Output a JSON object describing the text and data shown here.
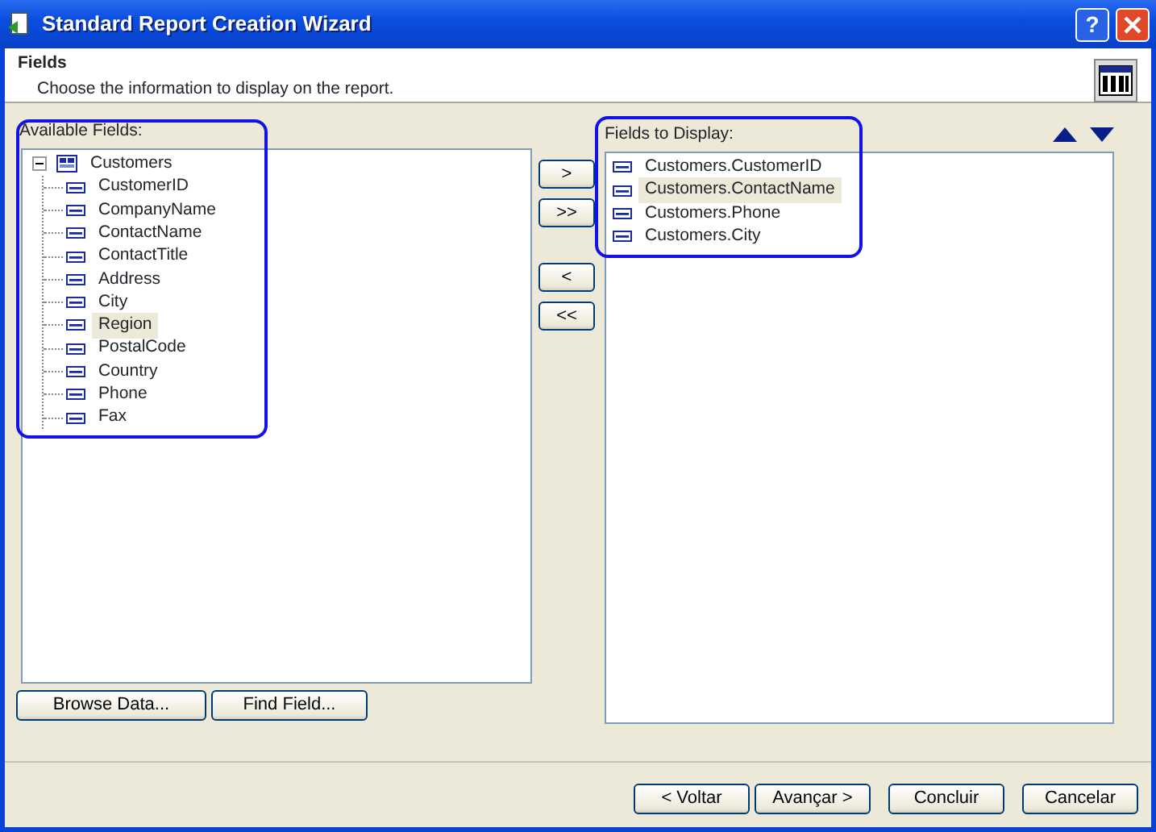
{
  "window": {
    "title": "Standard Report Creation Wizard",
    "help_button": "?"
  },
  "header": {
    "title": "Fields",
    "subtitle": "Choose the information to display on the report."
  },
  "available_fields": {
    "label": "Available Fields:",
    "tree": [
      {
        "label": "Customers",
        "expanded": true,
        "selected": false,
        "children": [
          {
            "label": "CustomerID",
            "selected": false
          },
          {
            "label": "CompanyName",
            "selected": false
          },
          {
            "label": "ContactName",
            "selected": false
          },
          {
            "label": "ContactTitle",
            "selected": false
          },
          {
            "label": "Address",
            "selected": false
          },
          {
            "label": "City",
            "selected": false
          },
          {
            "label": "Region",
            "selected": true
          },
          {
            "label": "PostalCode",
            "selected": false
          },
          {
            "label": "Country",
            "selected": false
          },
          {
            "label": "Phone",
            "selected": false
          },
          {
            "label": "Fax",
            "selected": false
          }
        ]
      }
    ]
  },
  "move_buttons": [
    ">",
    ">>",
    "<",
    "<<"
  ],
  "fields_to_display": {
    "label": "Fields to Display:",
    "items": [
      {
        "label": "Customers.CustomerID",
        "selected": false
      },
      {
        "label": "Customers.ContactName",
        "selected": true
      },
      {
        "label": "Customers.Phone",
        "selected": false
      },
      {
        "label": "Customers.City",
        "selected": false
      }
    ]
  },
  "left_buttons": [
    "Browse Data...",
    "Find Field..."
  ],
  "footer_buttons": [
    "< Voltar",
    "Avançar >",
    "Concluir",
    "Cancelar"
  ]
}
